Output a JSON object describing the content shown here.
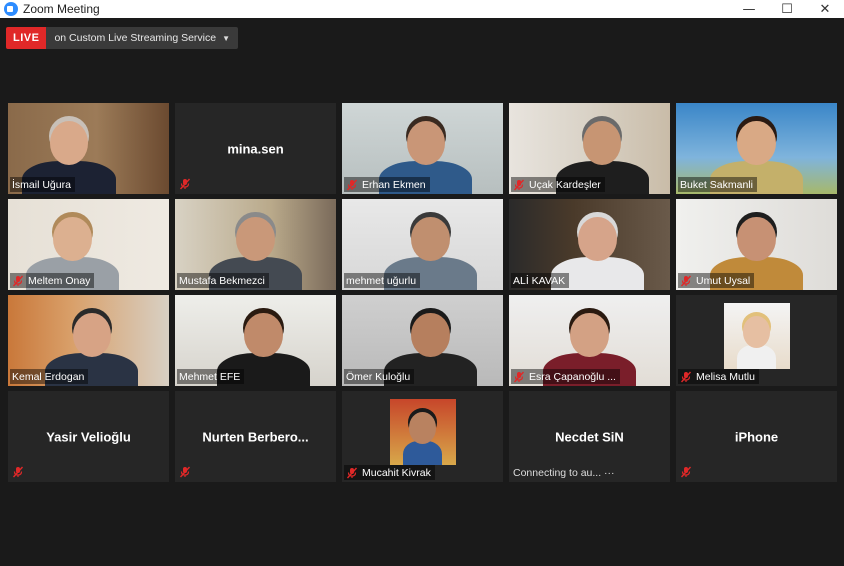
{
  "window": {
    "title": "Zoom Meeting",
    "minimize": "—",
    "maximize": "☐",
    "close": "✕"
  },
  "live": {
    "badge": "LIVE",
    "service": "on Custom Live Streaming Service",
    "caret": "▼"
  },
  "participants": [
    {
      "name": "İsmail Uğura",
      "video": true,
      "muted": false
    },
    {
      "name": "mina.sen",
      "video": false,
      "muted": true
    },
    {
      "name": "Erhan Ekmen",
      "video": true,
      "muted": true
    },
    {
      "name": "Uçak Kardeşler",
      "video": true,
      "muted": true
    },
    {
      "name": "Buket Sakmanli",
      "video": true,
      "muted": false
    },
    {
      "name": "Meltem Onay",
      "video": true,
      "muted": true
    },
    {
      "name": "Mustafa Bekmezci",
      "video": true,
      "muted": false
    },
    {
      "name": "mehmet uğurlu",
      "video": true,
      "muted": false
    },
    {
      "name": "ALİ KAVAK",
      "video": true,
      "muted": false
    },
    {
      "name": "Umut Uysal",
      "video": true,
      "muted": true
    },
    {
      "name": "Kemal Erdogan",
      "video": true,
      "muted": false
    },
    {
      "name": "Mehmet EFE",
      "video": true,
      "muted": false
    },
    {
      "name": "Ömer Kuloğlu",
      "video": true,
      "muted": false
    },
    {
      "name": "Esra Çapanoğlu ...",
      "video": true,
      "muted": true
    },
    {
      "name": "Melisa Mutlu",
      "video": true,
      "muted": true
    },
    {
      "name": "Yasir Velioğlu",
      "video": false,
      "muted": true
    },
    {
      "name": "Nurten  Berbero...",
      "video": false,
      "muted": true
    },
    {
      "name": "Mucahit Kivrak",
      "video": true,
      "muted": true
    },
    {
      "name": "Necdet SiN",
      "video": false,
      "muted": false,
      "status": "Connecting to au... ···"
    },
    {
      "name": "iPhone",
      "video": false,
      "muted": true
    }
  ],
  "colors": {
    "live_red": "#e02828",
    "active_speaker": "#b8e04a",
    "mute_red": "#e02828"
  }
}
